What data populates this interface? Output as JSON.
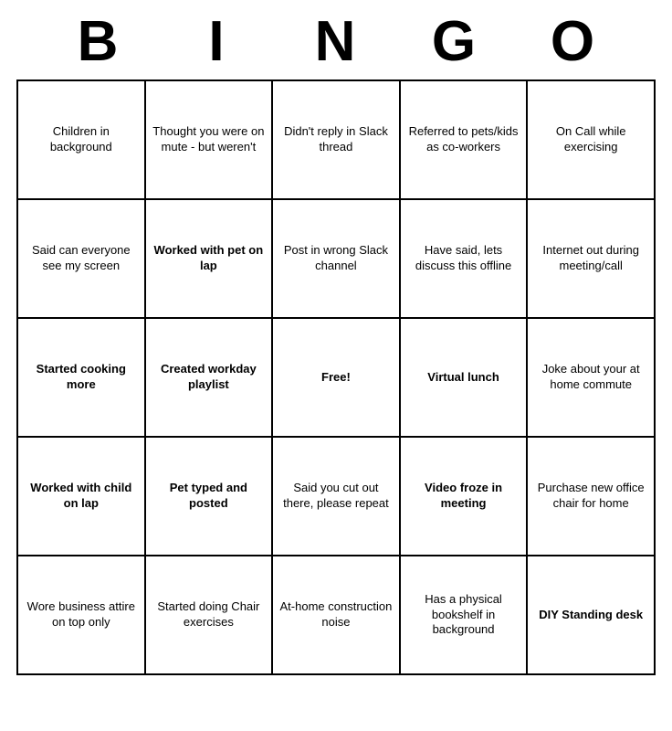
{
  "header": {
    "letters": [
      "B",
      "I",
      "N",
      "G",
      "O"
    ]
  },
  "grid": {
    "rows": [
      [
        {
          "text": "Children in background",
          "size": "normal"
        },
        {
          "text": "Thought you were on mute - but weren't",
          "size": "normal"
        },
        {
          "text": "Didn't reply in Slack thread",
          "size": "normal"
        },
        {
          "text": "Referred to pets/kids as co-workers",
          "size": "normal"
        },
        {
          "text": "On Call while exercising",
          "size": "normal"
        }
      ],
      [
        {
          "text": "Said can everyone see my screen",
          "size": "normal"
        },
        {
          "text": "Worked with pet on lap",
          "size": "large"
        },
        {
          "text": "Post in wrong Slack channel",
          "size": "normal"
        },
        {
          "text": "Have said, lets discuss this offline",
          "size": "normal"
        },
        {
          "text": "Internet out during meeting/call",
          "size": "normal"
        }
      ],
      [
        {
          "text": "Started cooking more",
          "size": "large"
        },
        {
          "text": "Created workday playlist",
          "size": "large"
        },
        {
          "text": "Free!",
          "size": "free"
        },
        {
          "text": "Virtual lunch",
          "size": "xlarge"
        },
        {
          "text": "Joke about your at home commute",
          "size": "normal"
        }
      ],
      [
        {
          "text": "Worked with child on lap",
          "size": "large"
        },
        {
          "text": "Pet typed and posted",
          "size": "large"
        },
        {
          "text": "Said you cut out there, please repeat",
          "size": "normal"
        },
        {
          "text": "Video froze in meeting",
          "size": "large"
        },
        {
          "text": "Purchase new office chair for home",
          "size": "normal"
        }
      ],
      [
        {
          "text": "Wore business attire on top only",
          "size": "normal"
        },
        {
          "text": "Started doing Chair exercises",
          "size": "normal"
        },
        {
          "text": "At-home construction noise",
          "size": "normal"
        },
        {
          "text": "Has a physical bookshelf in background",
          "size": "normal"
        },
        {
          "text": "DIY Standing desk",
          "size": "large"
        }
      ]
    ]
  }
}
